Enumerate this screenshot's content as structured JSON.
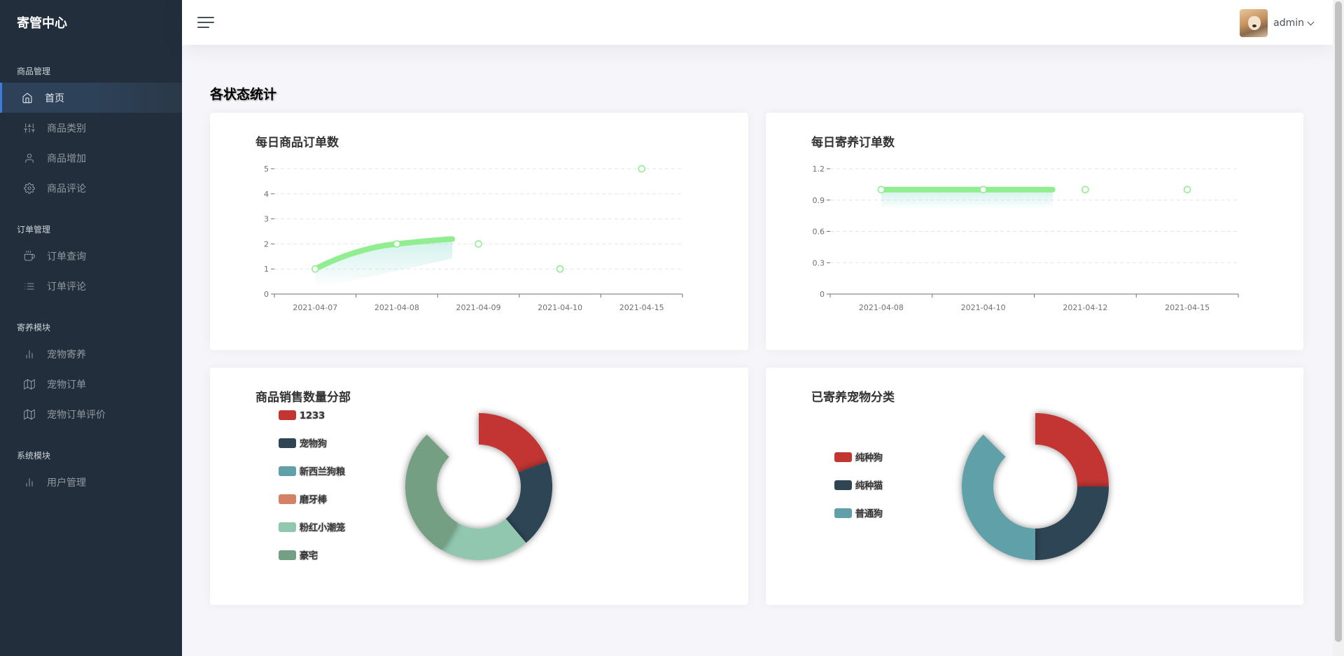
{
  "app": {
    "brand": "寄管中心"
  },
  "sidebar": {
    "sections": [
      {
        "header": "商品管理",
        "items": [
          {
            "label": "首页",
            "icon": "home-icon",
            "active": true
          },
          {
            "label": "商品类别",
            "icon": "sliders-icon"
          },
          {
            "label": "商品增加",
            "icon": "user-icon"
          },
          {
            "label": "商品评论",
            "icon": "gear-icon"
          }
        ]
      },
      {
        "header": "订单管理",
        "items": [
          {
            "label": "订单查询",
            "icon": "coffee-icon"
          },
          {
            "label": "订单评论",
            "icon": "list-icon"
          }
        ]
      },
      {
        "header": "寄养模块",
        "items": [
          {
            "label": "宠物寄养",
            "icon": "bar-chart-icon"
          },
          {
            "label": "宠物订单",
            "icon": "map-icon"
          },
          {
            "label": "宠物订单评价",
            "icon": "map-icon"
          }
        ]
      },
      {
        "header": "系统模块",
        "items": [
          {
            "label": "用户管理",
            "icon": "bar-chart-icon"
          }
        ]
      }
    ]
  },
  "topbar": {
    "user_name": "admin"
  },
  "main": {
    "title": "各状态统计"
  },
  "colors": {
    "line": "#90ee90",
    "pie": [
      "#c23531",
      "#2f4554",
      "#61a0a8",
      "#d48265",
      "#91c7ae",
      "#749f83"
    ]
  },
  "chart_data": [
    {
      "type": "line",
      "title": "每日商品订单数",
      "categories": [
        "2021-04-07",
        "2021-04-08",
        "2021-04-09",
        "2021-04-10",
        "2021-04-15"
      ],
      "values": [
        1,
        2,
        2,
        1,
        5
      ],
      "y_ticks": [
        "0",
        "1",
        "2",
        "3",
        "4",
        "5"
      ],
      "ylim": [
        0,
        5
      ],
      "grid": true
    },
    {
      "type": "line",
      "title": "每日寄养订单数",
      "categories": [
        "2021-04-08",
        "2021-04-10",
        "2021-04-12",
        "2021-04-15"
      ],
      "values": [
        1,
        1,
        1,
        1
      ],
      "y_ticks": [
        "0",
        "0.3",
        "0.6",
        "0.9",
        "1.2"
      ],
      "ylim": [
        0,
        1.2
      ],
      "grid": true
    },
    {
      "type": "pie",
      "title": "商品销售数量分部",
      "legend_position": "left",
      "slices": [
        {
          "name": "1233",
          "value": 1
        },
        {
          "name": "宠物狗",
          "value": 1
        },
        {
          "name": "新西兰狗粮",
          "value": 0
        },
        {
          "name": "磨牙棒",
          "value": 0
        },
        {
          "name": "粉红小潮笼",
          "value": 1
        },
        {
          "name": "豪宅",
          "value": 1.5
        }
      ]
    },
    {
      "type": "pie",
      "title": "已寄养宠物分类",
      "legend_position": "left",
      "slices": [
        {
          "name": "纯种狗",
          "value": 1
        },
        {
          "name": "纯种猫",
          "value": 1
        },
        {
          "name": "普通狗",
          "value": 1.5
        }
      ]
    }
  ]
}
